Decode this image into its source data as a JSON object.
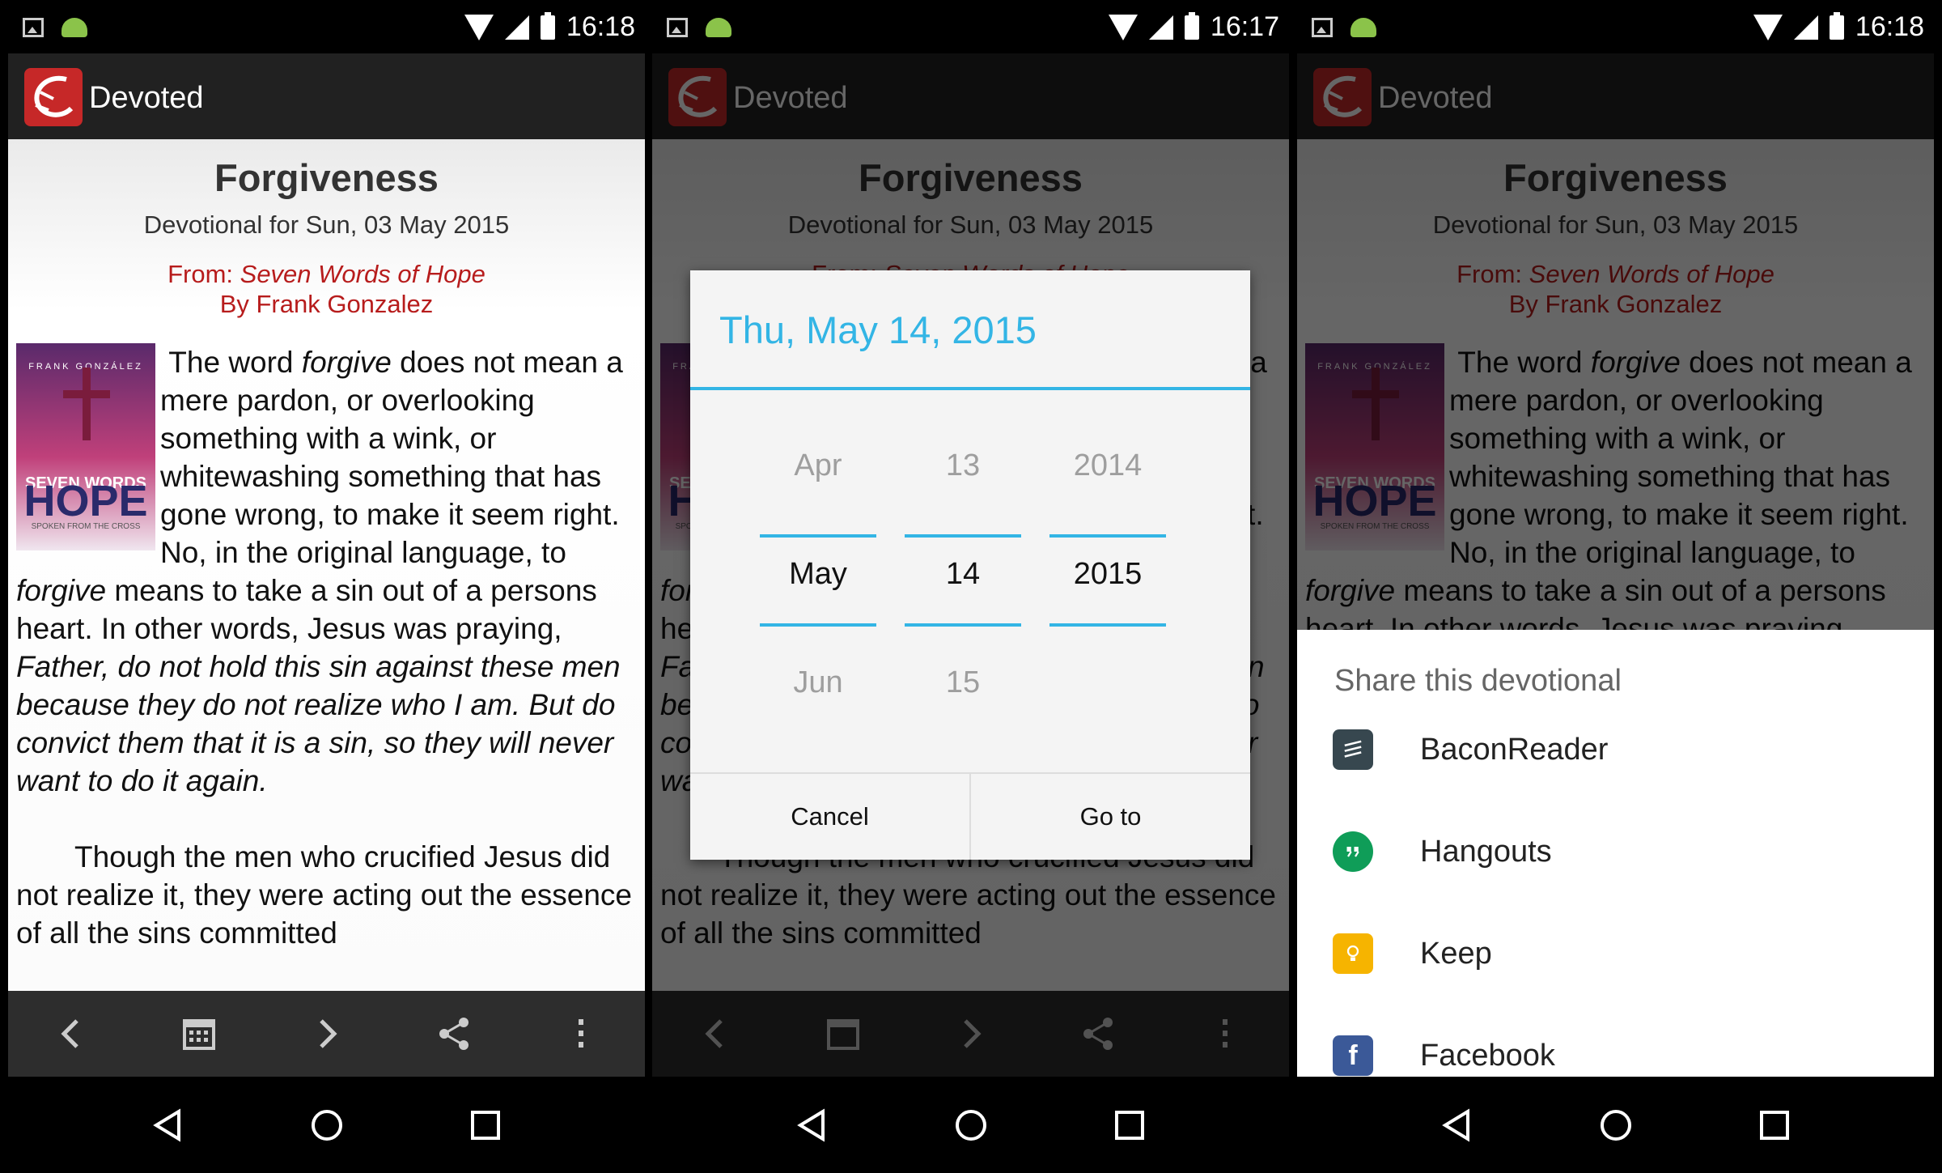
{
  "status_bars": [
    {
      "time": "16:18"
    },
    {
      "time": "16:17"
    },
    {
      "time": "16:18"
    }
  ],
  "app": {
    "title": "Devoted"
  },
  "devotional": {
    "title": "Forgiveness",
    "subtitle": "Devotional for Sun, 03 May 2015",
    "from_prefix": "From: ",
    "book_title": "Seven Words of Hope",
    "author_line": "By Frank Gonzalez",
    "cover": {
      "top": "FRANK GONZÁLEZ",
      "line1": "SEVEN WORDS",
      "line2": "HOPE",
      "bottom": "SPOKEN FROM THE CROSS"
    },
    "p1": [
      {
        "t": "The word ",
        "i": false
      },
      {
        "t": "forgive",
        "i": true
      },
      {
        "t": " does not mean a mere pardon, or overlooking something with a wink, or whitewashing something that has gone wrong, to make it seem right. No, in the original language, to ",
        "i": false
      },
      {
        "t": "forgive",
        "i": true
      },
      {
        "t": " means to take a sin out of a persons heart. In other words, Jesus was praying, ",
        "i": false
      },
      {
        "t": "Father, do not hold this sin against these men because they do not realize who I am. But do convict them that it is a sin, so they will never want to do it again.",
        "i": true
      }
    ],
    "p2": "Though the men who crucified Jesus did not realize it, they were acting out the essence of all the sins committed"
  },
  "date_dialog": {
    "title": "Thu, May 14, 2015",
    "month": {
      "prev": "Apr",
      "sel": "May",
      "next": "Jun"
    },
    "day": {
      "prev": "13",
      "sel": "14",
      "next": "15"
    },
    "year": {
      "prev": "2014",
      "sel": "2015",
      "next": ""
    },
    "cancel_label": "Cancel",
    "goto_label": "Go to"
  },
  "share_sheet": {
    "title": "Share this devotional",
    "items": [
      {
        "label": "BaconReader",
        "icon": "baconreader-icon",
        "color": "#37474f"
      },
      {
        "label": "Hangouts",
        "icon": "hangouts-icon",
        "color": "#0f9d58"
      },
      {
        "label": "Keep",
        "icon": "keep-icon",
        "color": "#f6b400"
      },
      {
        "label": "Facebook",
        "icon": "facebook-icon",
        "color": "#3b5998"
      }
    ]
  },
  "colors": {
    "accent": "#33b5e5",
    "source_red": "#b71c1c",
    "app_bar": "#212121",
    "toolbar": "#2d2d2d"
  }
}
